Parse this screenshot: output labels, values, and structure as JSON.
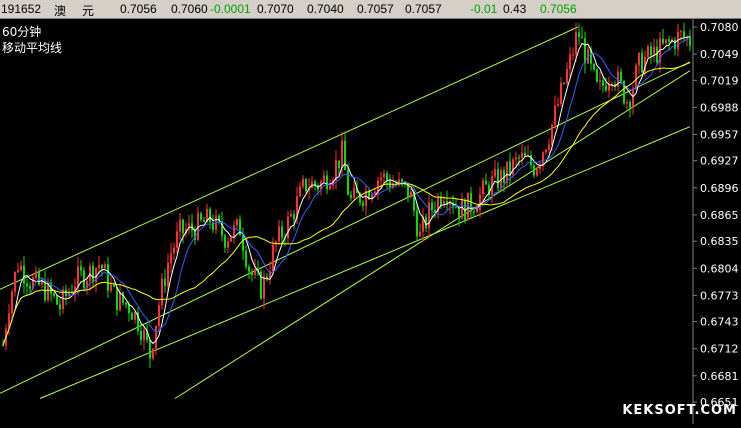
{
  "quote_bar": {
    "code": "191652",
    "name_part1": "澳",
    "name_part2": "元",
    "open": "0.7056",
    "close": "0.7060",
    "change": "-0.0001",
    "high": "0.7070",
    "low": "0.7040",
    "bid": "0.7057",
    "ask": "0.7057",
    "change2": "-0.01",
    "pct": "0.43",
    "last": "0.7056"
  },
  "chart_labels": {
    "period": "60分钟",
    "indicator": "移动平均线"
  },
  "watermark": "KEKSOFT.COM",
  "colors": {
    "background": "#000000",
    "up_candle": "#ff3030",
    "down_candle": "#00e000",
    "ma_fast": "#ffffff",
    "ma_mid": "#ffff00",
    "ma_slow": "#3060ff",
    "trendline": "#b0ff40",
    "axis_text": "#ffffff"
  },
  "chart_data": {
    "type": "candlestick",
    "y_ticks": [
      "0.7080",
      "0.7049",
      "0.7019",
      "0.6988",
      "0.6957",
      "0.6927",
      "0.6896",
      "0.6865",
      "0.6835",
      "0.6804",
      "0.6773",
      "0.6743",
      "0.6712",
      "0.6681",
      "0.6651"
    ],
    "ylim": [
      0.6651,
      0.708
    ],
    "price_path": [
      [
        0,
        0.669
      ],
      [
        8,
        0.676
      ],
      [
        18,
        0.681
      ],
      [
        30,
        0.679
      ],
      [
        45,
        0.678
      ],
      [
        60,
        0.676
      ],
      [
        75,
        0.679
      ],
      [
        90,
        0.68
      ],
      [
        100,
        0.681
      ],
      [
        115,
        0.677
      ],
      [
        130,
        0.676
      ],
      [
        140,
        0.674
      ],
      [
        150,
        0.6705
      ],
      [
        160,
        0.677
      ],
      [
        170,
        0.682
      ],
      [
        180,
        0.6845
      ],
      [
        195,
        0.685
      ],
      [
        210,
        0.686
      ],
      [
        225,
        0.684
      ],
      [
        240,
        0.685
      ],
      [
        250,
        0.68
      ],
      [
        262,
        0.678
      ],
      [
        275,
        0.683
      ],
      [
        290,
        0.686
      ],
      [
        305,
        0.69
      ],
      [
        320,
        0.69
      ],
      [
        335,
        0.692
      ],
      [
        342,
        0.6935
      ],
      [
        350,
        0.688
      ],
      [
        365,
        0.689
      ],
      [
        380,
        0.691
      ],
      [
        395,
        0.69
      ],
      [
        410,
        0.689
      ],
      [
        420,
        0.684
      ],
      [
        430,
        0.687
      ],
      [
        445,
        0.6895
      ],
      [
        460,
        0.687
      ],
      [
        475,
        0.688
      ],
      [
        490,
        0.69
      ],
      [
        505,
        0.691
      ],
      [
        520,
        0.693
      ],
      [
        535,
        0.692
      ],
      [
        550,
        0.696
      ],
      [
        560,
        0.7
      ],
      [
        570,
        0.704
      ],
      [
        578,
        0.7075
      ],
      [
        588,
        0.704
      ],
      [
        598,
        0.7005
      ],
      [
        612,
        0.703
      ],
      [
        628,
        0.6995
      ],
      [
        640,
        0.704
      ],
      [
        655,
        0.705
      ],
      [
        668,
        0.706
      ],
      [
        680,
        0.707
      ],
      [
        690,
        0.7065
      ]
    ],
    "trendlines": [
      [
        [
          0,
          0.678
        ],
        [
          578,
          0.708
        ]
      ],
      [
        [
          40,
          0.6655
        ],
        [
          690,
          0.6966
        ]
      ],
      [
        [
          175,
          0.6655
        ],
        [
          690,
          0.703
        ]
      ],
      [
        [
          0,
          0.6661
        ],
        [
          690,
          0.704
        ]
      ]
    ]
  }
}
